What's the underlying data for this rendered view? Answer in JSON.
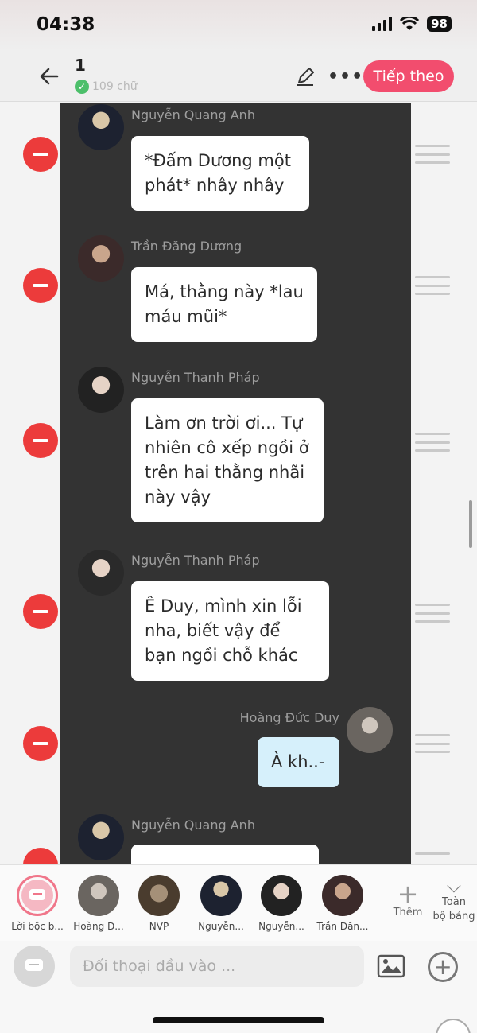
{
  "status": {
    "time": "04:38",
    "battery": "98"
  },
  "header": {
    "title": "1",
    "word_count": "109 chữ",
    "next_label": "Tiếp theo",
    "accent": "#f24d6e"
  },
  "messages": [
    {
      "speaker": "Nguyễn Quang Anh",
      "text": "*Đấm Dương một phát* nhây nhây",
      "self": false
    },
    {
      "speaker": "Trần Đăng Dương",
      "text": "Má, thằng này *lau máu mũi*",
      "self": false
    },
    {
      "speaker": "Nguyễn Thanh Pháp",
      "text": "Làm ơn trời ơi... Tự nhiên cô xếp ngồi ở trên hai thằng nhãi này vậy",
      "self": false
    },
    {
      "speaker": "Nguyễn Thanh Pháp",
      "text": "Ê Duy, mình xin lỗi nha, biết vậy để bạn ngồi chỗ khác",
      "self": false
    },
    {
      "speaker": "Hoàng Đức Duy",
      "text": "À kh..-",
      "self": true
    },
    {
      "speaker": "Nguyễn Quang Anh",
      "text": "",
      "self": false
    }
  ],
  "characters": [
    {
      "label": "Lời bộc b..."
    },
    {
      "label": "Hoàng Đ..."
    },
    {
      "label": "NVP"
    },
    {
      "label": "Nguyễn..."
    },
    {
      "label": "Nguyễn..."
    },
    {
      "label": "Trần Đăn..."
    }
  ],
  "toolbar": {
    "add_label": "Thêm",
    "full_board_line1": "Toàn",
    "full_board_line2": "bộ bảng"
  },
  "composer": {
    "placeholder": "Đối thoại đầu vào ..."
  },
  "colors": {
    "remove": "#ec3b3b",
    "chat_bg": "#333333",
    "self_bubble": "#d6f0fb"
  }
}
